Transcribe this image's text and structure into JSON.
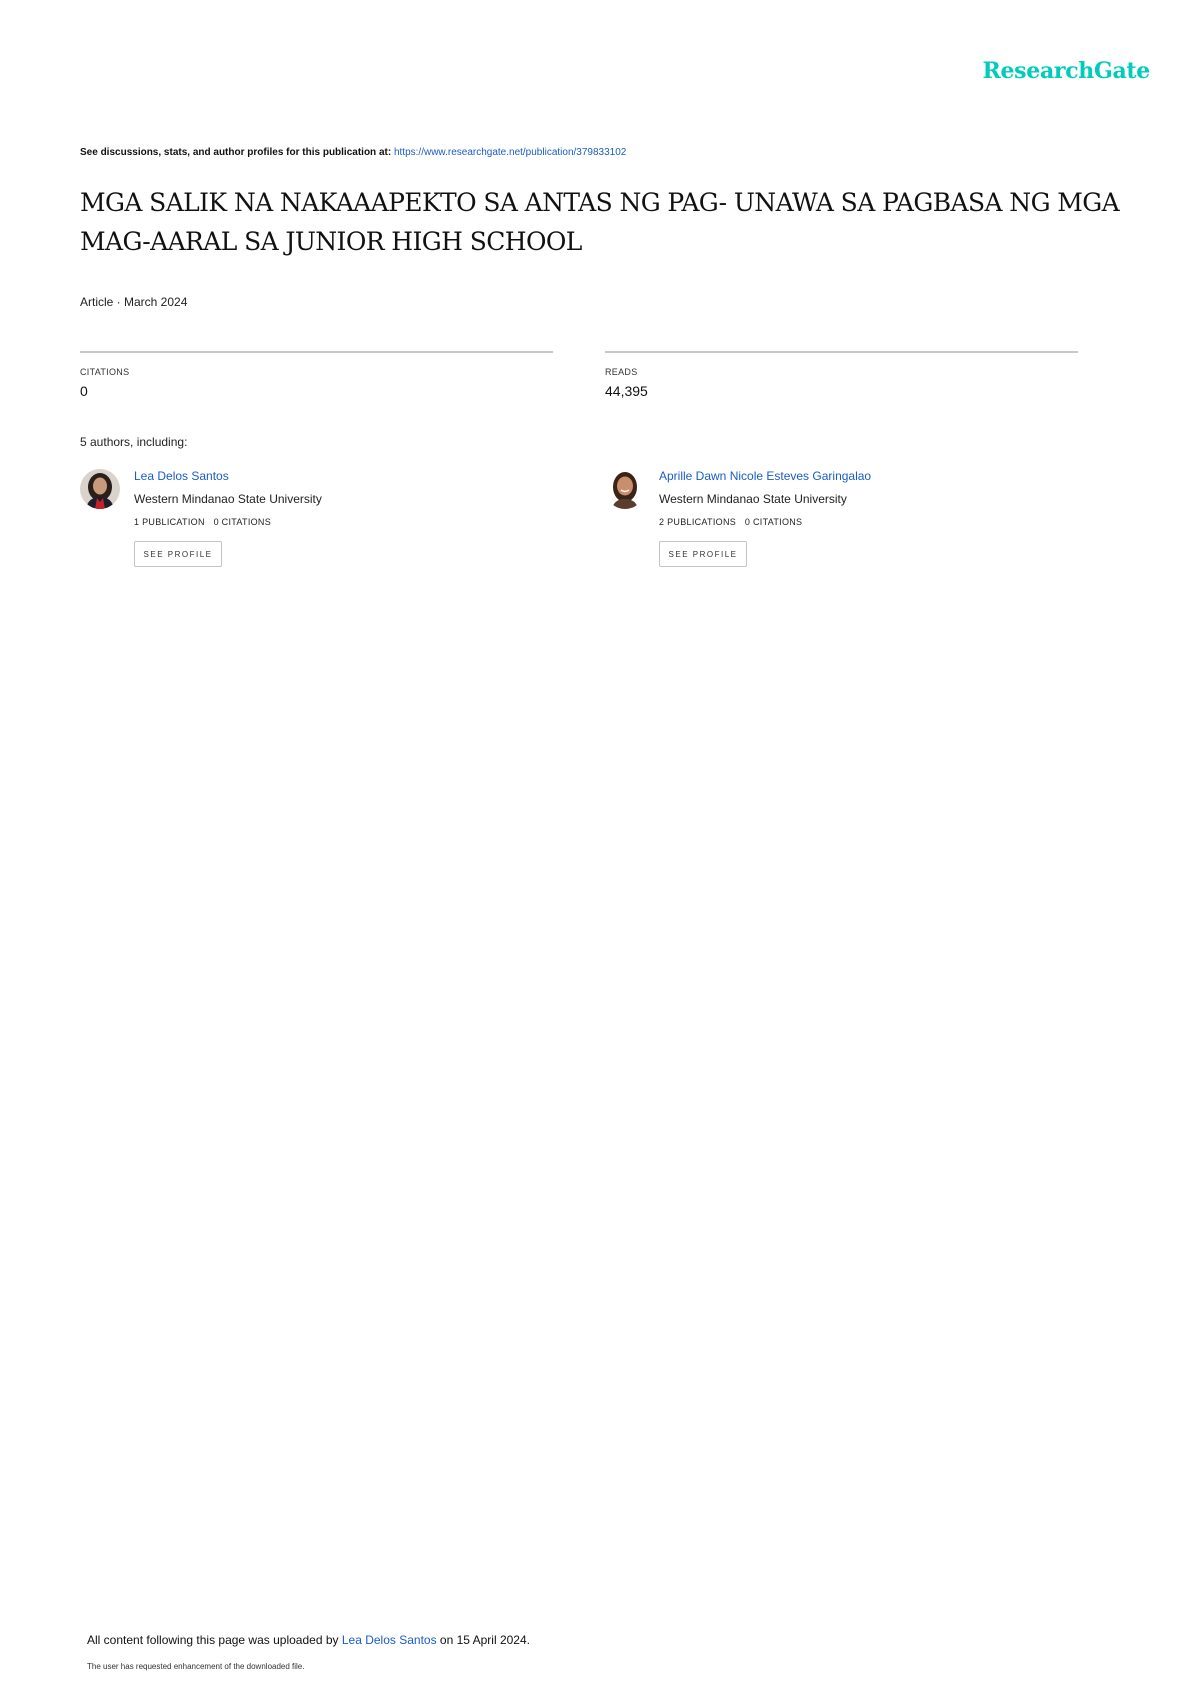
{
  "header": {
    "logo_text": "ResearchGate",
    "brand_color": "#00ccbb",
    "discussion_prefix": "See discussions, stats, and author profiles for this publication at: ",
    "publication_url": "https://www.researchgate.net/publication/379833102"
  },
  "article": {
    "title": "MGA SALIK NA NAKAAAPEKTO SA ANTAS NG PAG- UNAWA SA PAGBASA NG MGA MAG-AARAL SA JUNIOR HIGH SCHOOL",
    "meta": "Article · March 2024"
  },
  "stats": {
    "citations_label": "CITATIONS",
    "citations_value": "0",
    "reads_label": "READS",
    "reads_value": "44,395"
  },
  "authors_heading": "5 authors, including:",
  "authors": [
    {
      "name": "Lea Delos Santos",
      "affiliation": "Western Mindanao State University",
      "publications": "1 PUBLICATION",
      "citations": "0 CITATIONS",
      "button_label": "SEE PROFILE"
    },
    {
      "name": "Aprille Dawn Nicole Esteves Garingalao",
      "affiliation": "Western Mindanao State University",
      "publications": "2 PUBLICATIONS",
      "citations": "0 CITATIONS",
      "button_label": "SEE PROFILE"
    }
  ],
  "footer": {
    "upload_prefix": "All content following this page was uploaded by ",
    "uploader": "Lea Delos Santos",
    "upload_suffix": " on 15 April 2024.",
    "note": "The user has requested enhancement of the downloaded file."
  },
  "colors": {
    "link": "#1a5cc8",
    "divider": "#c8c8c8"
  }
}
